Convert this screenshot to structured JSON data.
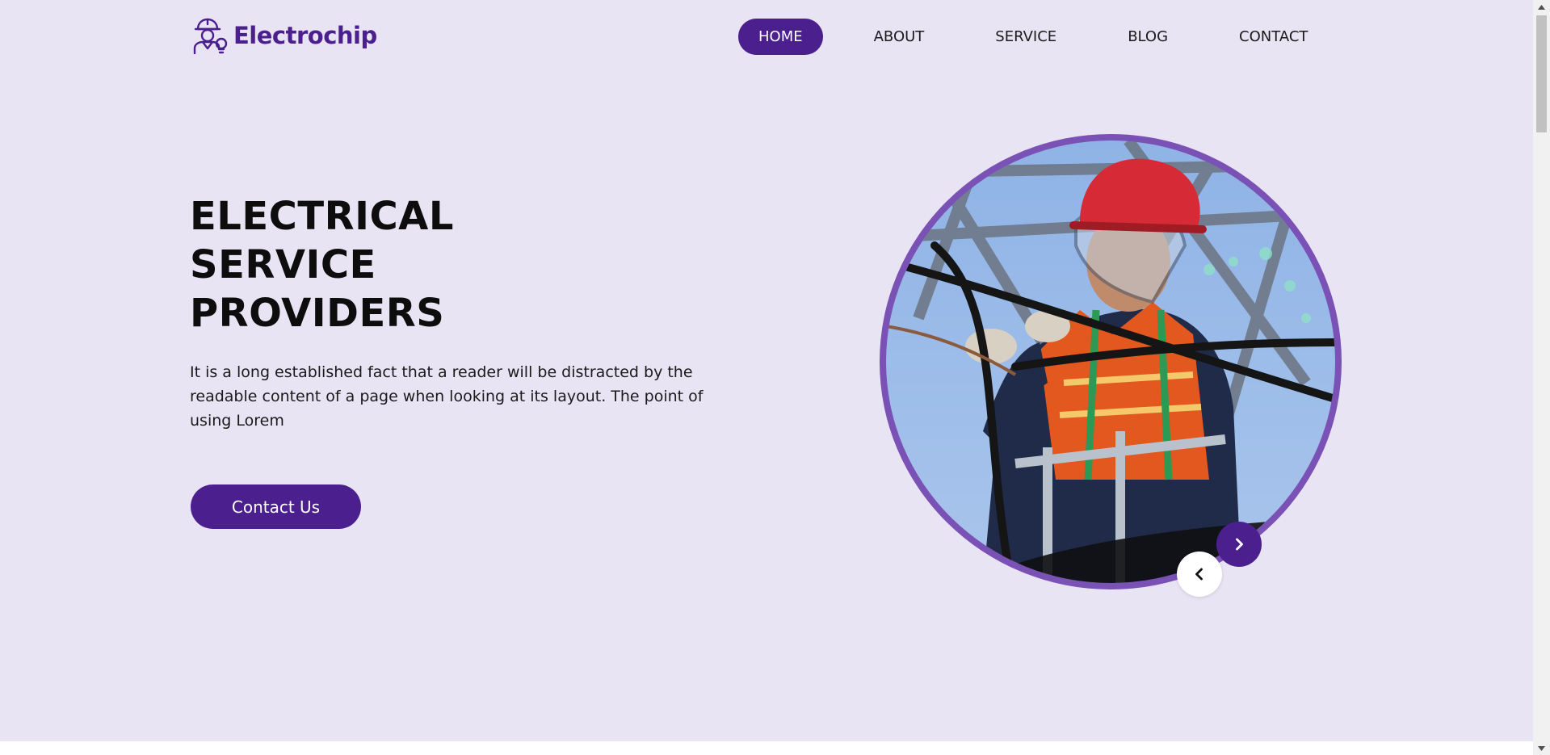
{
  "brand": {
    "name": "Electrochip",
    "logo_icon": "electrician-with-lightbulb-icon"
  },
  "nav": {
    "items": [
      {
        "label": "HOME",
        "active": true
      },
      {
        "label": "ABOUT",
        "active": false
      },
      {
        "label": "SERVICE",
        "active": false
      },
      {
        "label": "BLOG",
        "active": false
      },
      {
        "label": "CONTACT",
        "active": false
      }
    ]
  },
  "hero": {
    "title_lines": [
      "ELECTRICAL",
      "SERVICE",
      "PROVIDERS"
    ],
    "lead": "It is a long established fact that a reader will be distracted by the readable content of a page when looking at its layout. The point of using Lorem",
    "cta_label": "Contact Us",
    "image_subject": "electrician-on-utility-pole",
    "slider": {
      "prev_icon": "chevron-left-icon",
      "next_icon": "chevron-right-icon"
    }
  },
  "colors": {
    "accent": "#4b1f8e",
    "ring": "#7a51b5",
    "background": "#e9e4f4"
  }
}
